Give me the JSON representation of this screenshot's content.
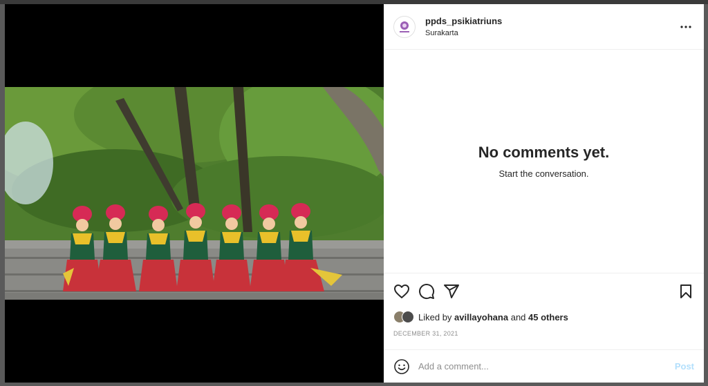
{
  "post": {
    "username": "ppds_psikiatriuns",
    "location": "Surakarta",
    "photo_alt": "Seven dancers in red and gold traditional costumes seated on stone steps under trees"
  },
  "comments": {
    "empty_title": "No comments yet.",
    "empty_subtitle": "Start the conversation."
  },
  "likes": {
    "prefix": "Liked by",
    "user": "avillayohana",
    "connector": "and",
    "others": "45 others"
  },
  "date": "DECEMBER 31, 2021",
  "composer": {
    "placeholder": "Add a comment...",
    "post_label": "Post"
  },
  "icons": {
    "more": "more-horizontal-icon",
    "like": "heart-icon",
    "comment": "comment-bubble-icon",
    "share": "paper-plane-icon",
    "save": "bookmark-icon",
    "emoji": "smiley-icon"
  },
  "colors": {
    "post_button": "#b2dffc",
    "muted_text": "#8e8e8e",
    "primary_text": "#262626"
  }
}
